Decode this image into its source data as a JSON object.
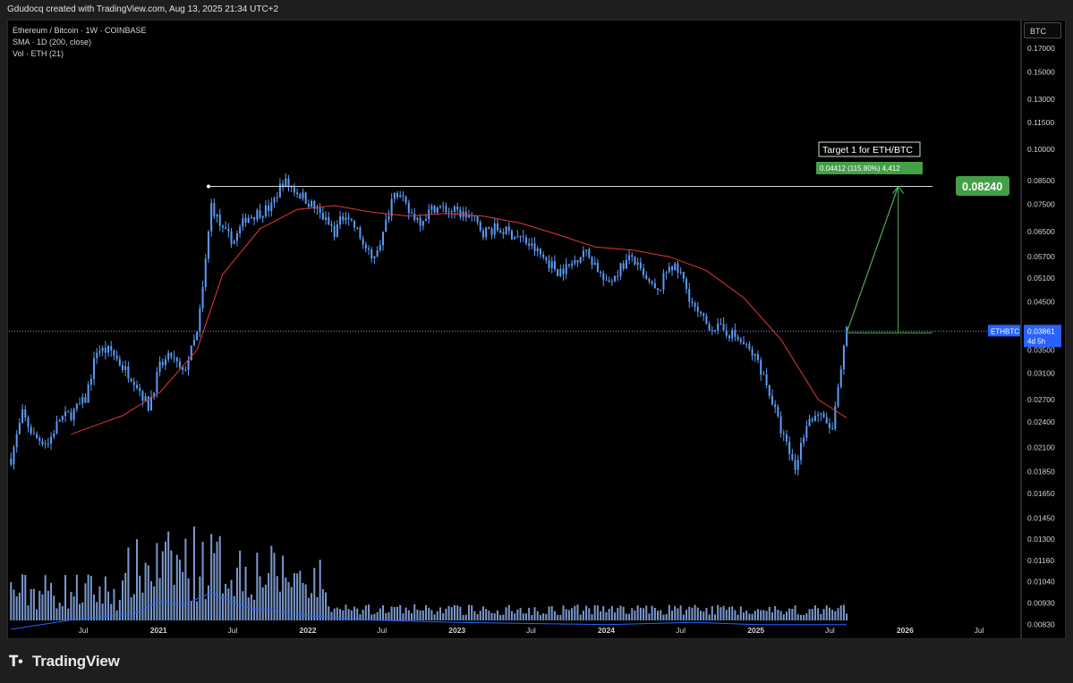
{
  "header": {
    "attribution": "Gdudocq created with TradingView.com, Aug 13, 2025 21:34 UTC+2"
  },
  "legend": {
    "symbol": "Ethereum / Bitcoin · 1W · COINBASE",
    "sma": "SMA · 1D (200, close)",
    "volume": "Vol · ETH (21)"
  },
  "price_scale": {
    "unit": "BTC",
    "current_symbol": "ETHBTC",
    "current_price": "0.03861",
    "countdown": "4d 5h"
  },
  "annotation": {
    "target_title": "Target 1 for ETH/BTC",
    "measure": "0.04412 (115.80%) 4,412",
    "target_price": "0.08240"
  },
  "footer": {
    "brand": "TradingView"
  },
  "colors": {
    "background": "#000000",
    "candle": "#5b9cf6",
    "sma": "#e53935",
    "target_green": "#4caf50",
    "horizontal_line": "#d1d4dc"
  },
  "chart_data": {
    "type": "line",
    "title": "Ethereum / Bitcoin · 1W · COINBASE",
    "y_scale": "log",
    "ylim": [
      0.0078,
      0.19
    ],
    "y_ticks": [
      "0.17000",
      "0.15000",
      "0.13000",
      "0.11500",
      "0.10000",
      "0.08500",
      "0.07500",
      "0.06500",
      "0.05700",
      "0.05100",
      "0.04500",
      "0.03500",
      "0.03100",
      "0.02700",
      "0.02400",
      "0.02100",
      "0.01850",
      "0.01650",
      "0.01450",
      "0.01300",
      "0.01160",
      "0.01040",
      "0.00930",
      "0.00830"
    ],
    "x_ticks": [
      "Jul",
      "2021",
      "Jul",
      "2022",
      "Jul",
      "2023",
      "Jul",
      "2024",
      "Jul",
      "2025",
      "Jul",
      "2026",
      "Jul"
    ],
    "x_tick_dates": [
      "2020-07-01",
      "2021-01-01",
      "2021-07-01",
      "2022-01-01",
      "2022-07-01",
      "2023-01-01",
      "2023-07-01",
      "2024-01-01",
      "2024-07-01",
      "2025-01-01",
      "2025-07-01",
      "2026-01-01",
      "2026-07-01"
    ],
    "series": [
      {
        "name": "ETHBTC",
        "x": [
          "2020-01-06",
          "2020-02-03",
          "2020-03-02",
          "2020-04-06",
          "2020-05-04",
          "2020-06-01",
          "2020-07-06",
          "2020-08-03",
          "2020-09-07",
          "2020-10-05",
          "2020-11-02",
          "2020-12-07",
          "2021-01-04",
          "2021-02-01",
          "2021-03-01",
          "2021-04-05",
          "2021-04-19",
          "2021-05-10",
          "2021-06-07",
          "2021-07-05",
          "2021-08-02",
          "2021-09-06",
          "2021-10-04",
          "2021-11-01",
          "2021-12-06",
          "2022-01-03",
          "2022-02-07",
          "2022-03-07",
          "2022-04-04",
          "2022-05-02",
          "2022-06-06",
          "2022-07-04",
          "2022-08-01",
          "2022-09-05",
          "2022-10-03",
          "2022-11-07",
          "2022-12-05",
          "2023-01-02",
          "2023-02-06",
          "2023-03-06",
          "2023-04-03",
          "2023-05-01",
          "2023-06-05",
          "2023-07-03",
          "2023-08-07",
          "2023-09-04",
          "2023-10-02",
          "2023-11-06",
          "2023-12-04",
          "2024-01-01",
          "2024-02-05",
          "2024-03-04",
          "2024-04-01",
          "2024-05-06",
          "2024-06-03",
          "2024-07-01",
          "2024-08-05",
          "2024-09-02",
          "2024-10-07",
          "2024-11-04",
          "2024-12-02",
          "2025-01-06",
          "2025-02-03",
          "2025-03-03",
          "2025-04-07",
          "2025-05-05",
          "2025-06-02",
          "2025-07-07",
          "2025-08-11"
        ],
        "values": [
          0.0198,
          0.025,
          0.0222,
          0.0215,
          0.0244,
          0.025,
          0.027,
          0.035,
          0.0348,
          0.032,
          0.03,
          0.026,
          0.032,
          0.034,
          0.0308,
          0.038,
          0.048,
          0.075,
          0.065,
          0.062,
          0.07,
          0.072,
          0.074,
          0.085,
          0.08,
          0.076,
          0.07,
          0.065,
          0.072,
          0.065,
          0.056,
          0.064,
          0.082,
          0.072,
          0.069,
          0.074,
          0.073,
          0.072,
          0.07,
          0.065,
          0.066,
          0.065,
          0.063,
          0.06,
          0.056,
          0.053,
          0.054,
          0.059,
          0.055,
          0.049,
          0.054,
          0.057,
          0.051,
          0.047,
          0.055,
          0.052,
          0.043,
          0.04,
          0.039,
          0.038,
          0.036,
          0.033,
          0.028,
          0.023,
          0.0188,
          0.024,
          0.025,
          0.023,
          0.0386
        ]
      },
      {
        "name": "SMA · 1D (200, close)",
        "x": [
          "2020-06-01",
          "2020-10-05",
          "2021-01-04",
          "2021-04-05",
          "2021-06-07",
          "2021-09-06",
          "2021-12-06",
          "2022-03-07",
          "2022-06-06",
          "2022-09-05",
          "2022-12-05",
          "2023-03-06",
          "2023-06-05",
          "2023-09-04",
          "2023-12-04",
          "2024-03-04",
          "2024-06-03",
          "2024-09-02",
          "2024-12-02",
          "2025-03-03",
          "2025-06-02",
          "2025-08-11"
        ],
        "values": [
          0.0225,
          0.0248,
          0.028,
          0.035,
          0.052,
          0.066,
          0.073,
          0.0745,
          0.072,
          0.0705,
          0.0715,
          0.0705,
          0.068,
          0.064,
          0.06,
          0.059,
          0.057,
          0.053,
          0.046,
          0.037,
          0.027,
          0.0245
        ]
      },
      {
        "name": "Vol · ETH (21)",
        "x": [
          "2020-01-06",
          "2020-06-01",
          "2020-11-02",
          "2021-01-04",
          "2021-03-01",
          "2021-05-10",
          "2021-08-02",
          "2022-01-03",
          "2022-06-06",
          "2023-01-02",
          "2024-01-01",
          "2024-08-05",
          "2025-01-06",
          "2025-08-11"
        ],
        "values": [
          0.0081,
          0.0085,
          0.0088,
          0.0094,
          0.0092,
          0.0098,
          0.0091,
          0.0087,
          0.0085,
          0.0084,
          0.0083,
          0.0084,
          0.0083,
          0.0083
        ]
      }
    ],
    "horizontal_level": 0.0824,
    "measure": {
      "from": 0.03828,
      "to": 0.0824,
      "change": "0.04412 (115.80%) 4,412"
    }
  }
}
